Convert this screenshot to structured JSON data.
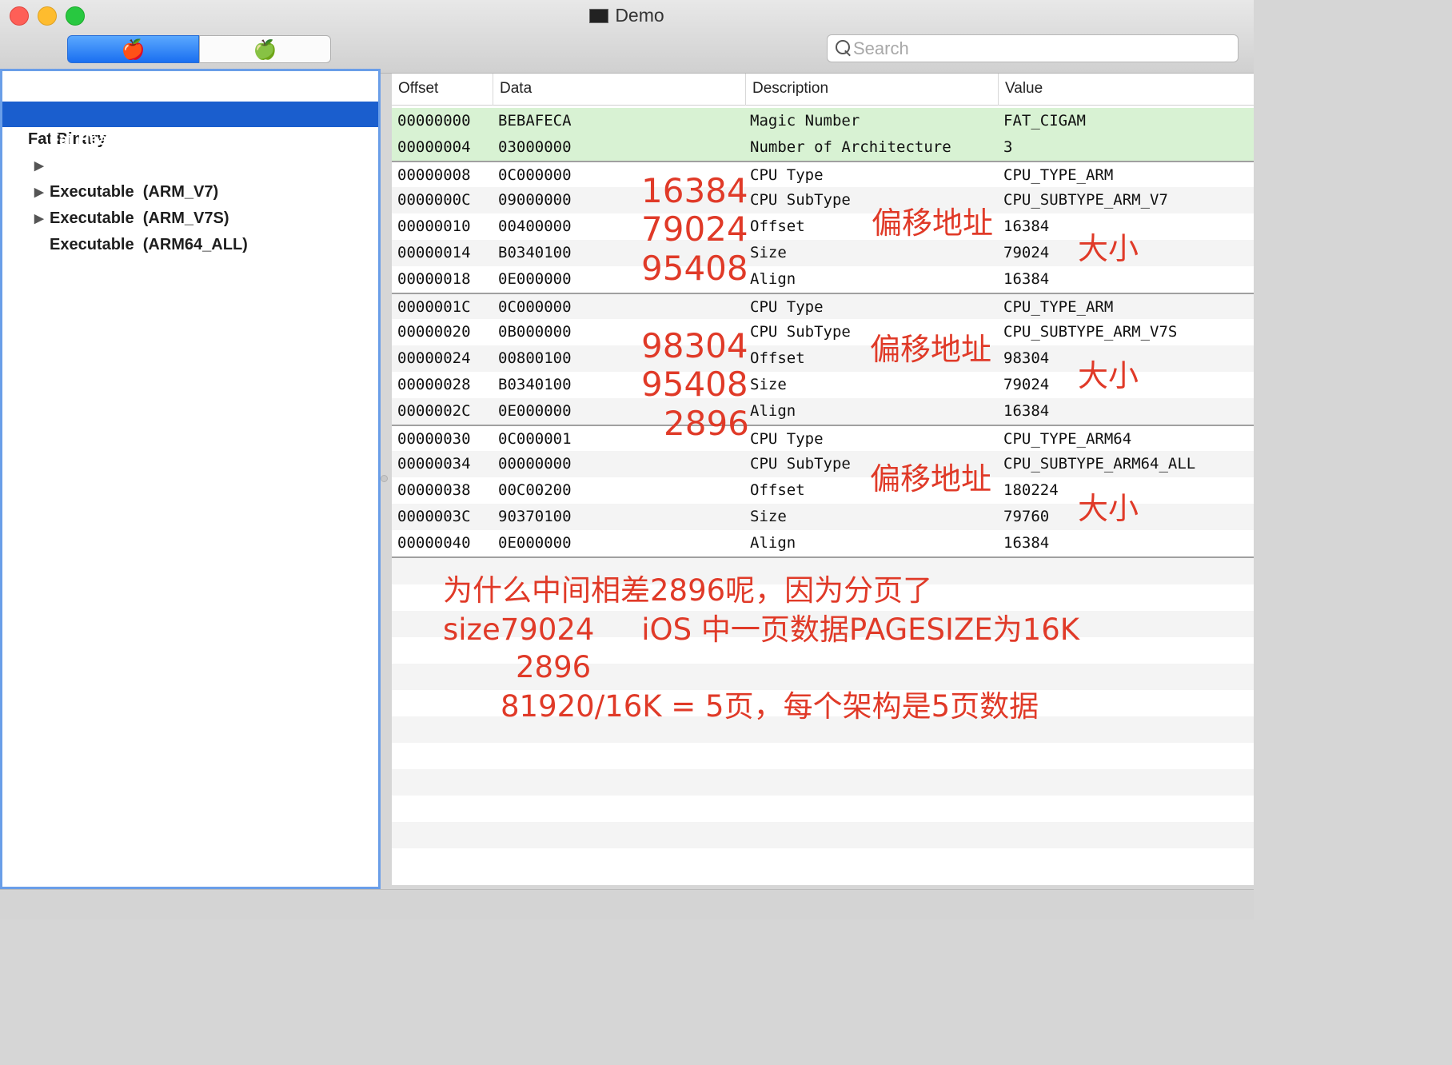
{
  "window": {
    "title": "Demo"
  },
  "toolbar": {
    "segments": [
      {
        "icon": "red-apple-icon",
        "glyph": "🍎",
        "selected": true
      },
      {
        "icon": "gray-apple-icon",
        "glyph": "🍏",
        "selected": false
      }
    ],
    "search_placeholder": "Search",
    "search_value": ""
  },
  "sidebar": {
    "items": [
      {
        "label": "Fat Binary",
        "expanded": true,
        "selected": false
      },
      {
        "label": "Fat Header",
        "selected": true
      },
      {
        "label": "Executable  (ARM_V7)",
        "expanded": false
      },
      {
        "label": "Executable  (ARM_V7S)",
        "expanded": false
      },
      {
        "label": "Executable  (ARM64_ALL)",
        "expanded": false
      }
    ]
  },
  "table": {
    "columns": [
      "Offset",
      "Data",
      "Description",
      "Value"
    ],
    "rows": [
      {
        "offset": "00000000",
        "data": "BEBAFECA",
        "description": "Magic Number",
        "value": "FAT_CIGAM"
      },
      {
        "offset": "00000004",
        "data": "03000000",
        "description": "Number of Architecture",
        "value": "3"
      },
      {
        "offset": "00000008",
        "data": "0C000000",
        "description": "CPU Type",
        "value": "CPU_TYPE_ARM"
      },
      {
        "offset": "0000000C",
        "data": "09000000",
        "description": "CPU SubType",
        "value": "CPU_SUBTYPE_ARM_V7"
      },
      {
        "offset": "00000010",
        "data": "00400000",
        "description": "Offset",
        "value": "16384"
      },
      {
        "offset": "00000014",
        "data": "B0340100",
        "description": "Size",
        "value": "79024"
      },
      {
        "offset": "00000018",
        "data": "0E000000",
        "description": "Align",
        "value": "16384"
      },
      {
        "offset": "0000001C",
        "data": "0C000000",
        "description": "CPU Type",
        "value": "CPU_TYPE_ARM"
      },
      {
        "offset": "00000020",
        "data": "0B000000",
        "description": "CPU SubType",
        "value": "CPU_SUBTYPE_ARM_V7S"
      },
      {
        "offset": "00000024",
        "data": "00800100",
        "description": "Offset",
        "value": "98304"
      },
      {
        "offset": "00000028",
        "data": "B0340100",
        "description": "Size",
        "value": "79024"
      },
      {
        "offset": "0000002C",
        "data": "0E000000",
        "description": "Align",
        "value": "16384"
      },
      {
        "offset": "00000030",
        "data": "0C000001",
        "description": "CPU Type",
        "value": "CPU_TYPE_ARM64"
      },
      {
        "offset": "00000034",
        "data": "00000000",
        "description": "CPU SubType",
        "value": "CPU_SUBTYPE_ARM64_ALL"
      },
      {
        "offset": "00000038",
        "data": "00C00200",
        "description": "Offset",
        "value": "180224"
      },
      {
        "offset": "0000003C",
        "data": "90370100",
        "description": "Size",
        "value": "79760"
      },
      {
        "offset": "00000040",
        "data": "0E000000",
        "description": "Align",
        "value": "16384"
      }
    ]
  },
  "annotations": {
    "numbers": [
      "16384",
      "79024",
      "95408",
      "98304",
      "95408",
      "2896"
    ],
    "offset_label": "偏移地址",
    "size_label": "大小",
    "notes": [
      "为什么中间相差2896呢，因为分页了",
      "size79024     iOS 中一页数据PAGESIZE为16K",
      "2896",
      "81920/16K = 5页，每个架构是5页数据"
    ]
  },
  "colors": {
    "annotation": "#e03a28",
    "selection": "#1a5ece",
    "header_highlight": "#d8f2d3"
  }
}
